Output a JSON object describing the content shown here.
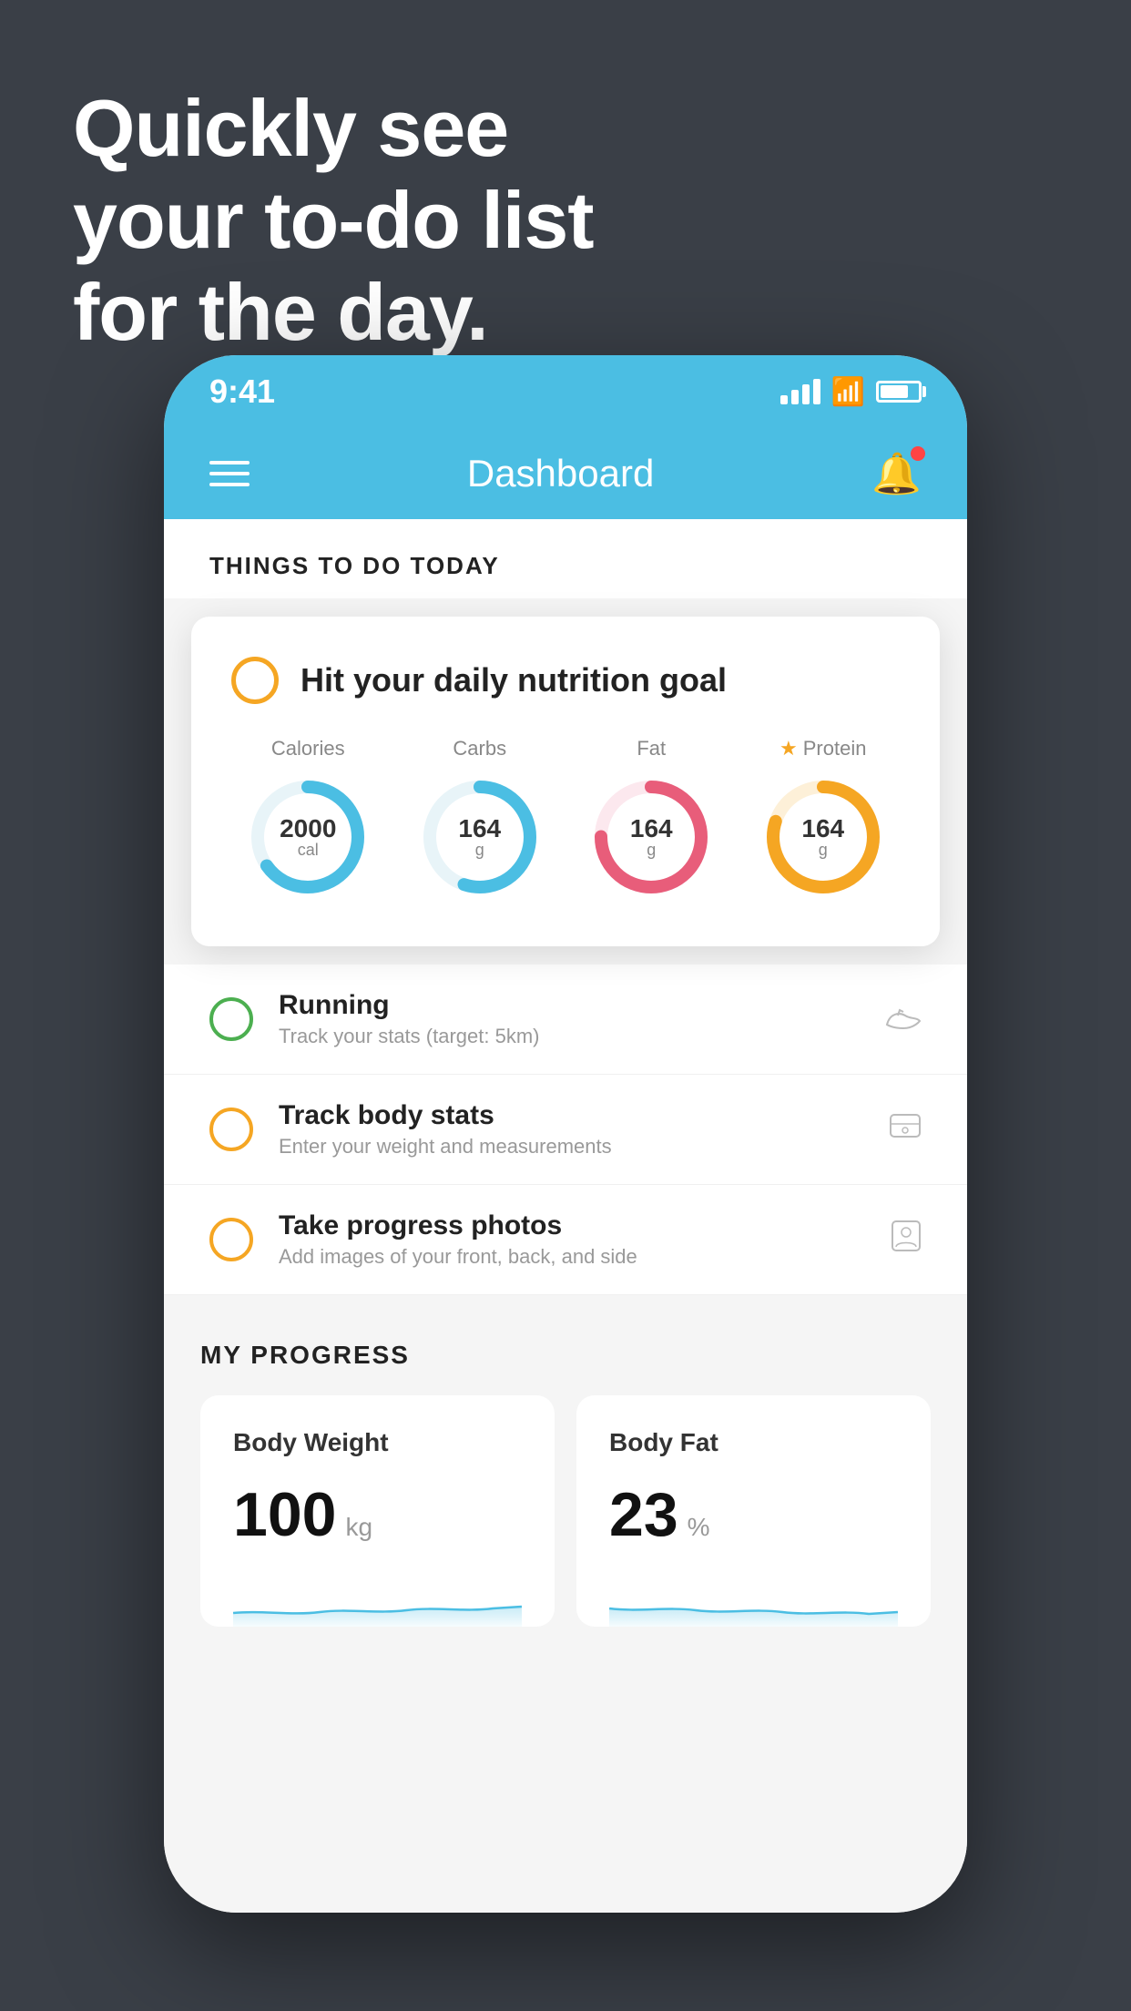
{
  "hero": {
    "line1": "Quickly see",
    "line2": "your to-do list",
    "line3": "for the day."
  },
  "phone": {
    "statusBar": {
      "time": "9:41"
    },
    "navBar": {
      "title": "Dashboard"
    },
    "content": {
      "sectionHeader": "THINGS TO DO TODAY",
      "featuredCard": {
        "title": "Hit your daily nutrition goal",
        "goals": [
          {
            "label": "Calories",
            "value": "2000",
            "unit": "cal",
            "color": "#4bbee3",
            "progress": 0.65
          },
          {
            "label": "Carbs",
            "value": "164",
            "unit": "g",
            "color": "#4bbee3",
            "progress": 0.55
          },
          {
            "label": "Fat",
            "value": "164",
            "unit": "g",
            "color": "#e85d7a",
            "progress": 0.75
          },
          {
            "label": "Protein",
            "value": "164",
            "unit": "g",
            "color": "#f5a623",
            "progress": 0.8,
            "starred": true
          }
        ]
      },
      "listItems": [
        {
          "title": "Running",
          "subtitle": "Track your stats (target: 5km)",
          "circleColor": "green",
          "icon": "👟"
        },
        {
          "title": "Track body stats",
          "subtitle": "Enter your weight and measurements",
          "circleColor": "yellow",
          "icon": "⚖️"
        },
        {
          "title": "Take progress photos",
          "subtitle": "Add images of your front, back, and side",
          "circleColor": "yellow",
          "icon": "👤"
        }
      ],
      "progressSection": {
        "title": "MY PROGRESS",
        "cards": [
          {
            "title": "Body Weight",
            "value": "100",
            "unit": "kg"
          },
          {
            "title": "Body Fat",
            "value": "23",
            "unit": "%"
          }
        ]
      }
    }
  }
}
